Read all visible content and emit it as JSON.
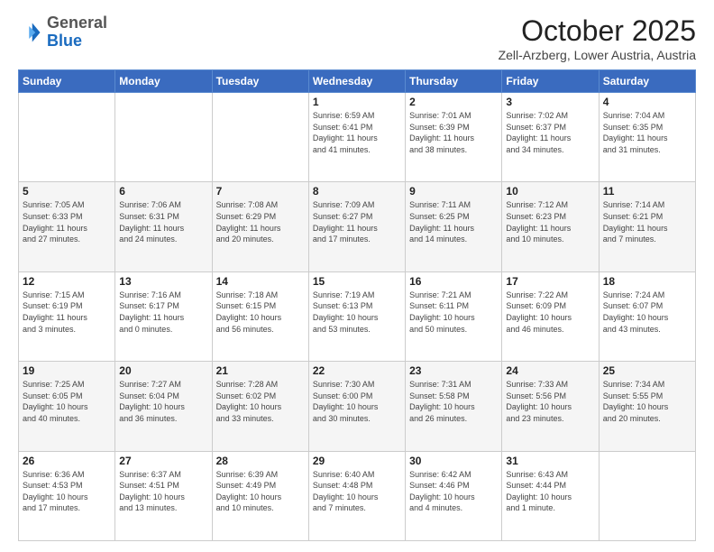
{
  "header": {
    "logo_general": "General",
    "logo_blue": "Blue",
    "month_title": "October 2025",
    "location": "Zell-Arzberg, Lower Austria, Austria"
  },
  "days_of_week": [
    "Sunday",
    "Monday",
    "Tuesday",
    "Wednesday",
    "Thursday",
    "Friday",
    "Saturday"
  ],
  "weeks": [
    [
      {
        "day": "",
        "info": ""
      },
      {
        "day": "",
        "info": ""
      },
      {
        "day": "",
        "info": ""
      },
      {
        "day": "1",
        "info": "Sunrise: 6:59 AM\nSunset: 6:41 PM\nDaylight: 11 hours\nand 41 minutes."
      },
      {
        "day": "2",
        "info": "Sunrise: 7:01 AM\nSunset: 6:39 PM\nDaylight: 11 hours\nand 38 minutes."
      },
      {
        "day": "3",
        "info": "Sunrise: 7:02 AM\nSunset: 6:37 PM\nDaylight: 11 hours\nand 34 minutes."
      },
      {
        "day": "4",
        "info": "Sunrise: 7:04 AM\nSunset: 6:35 PM\nDaylight: 11 hours\nand 31 minutes."
      }
    ],
    [
      {
        "day": "5",
        "info": "Sunrise: 7:05 AM\nSunset: 6:33 PM\nDaylight: 11 hours\nand 27 minutes."
      },
      {
        "day": "6",
        "info": "Sunrise: 7:06 AM\nSunset: 6:31 PM\nDaylight: 11 hours\nand 24 minutes."
      },
      {
        "day": "7",
        "info": "Sunrise: 7:08 AM\nSunset: 6:29 PM\nDaylight: 11 hours\nand 20 minutes."
      },
      {
        "day": "8",
        "info": "Sunrise: 7:09 AM\nSunset: 6:27 PM\nDaylight: 11 hours\nand 17 minutes."
      },
      {
        "day": "9",
        "info": "Sunrise: 7:11 AM\nSunset: 6:25 PM\nDaylight: 11 hours\nand 14 minutes."
      },
      {
        "day": "10",
        "info": "Sunrise: 7:12 AM\nSunset: 6:23 PM\nDaylight: 11 hours\nand 10 minutes."
      },
      {
        "day": "11",
        "info": "Sunrise: 7:14 AM\nSunset: 6:21 PM\nDaylight: 11 hours\nand 7 minutes."
      }
    ],
    [
      {
        "day": "12",
        "info": "Sunrise: 7:15 AM\nSunset: 6:19 PM\nDaylight: 11 hours\nand 3 minutes."
      },
      {
        "day": "13",
        "info": "Sunrise: 7:16 AM\nSunset: 6:17 PM\nDaylight: 11 hours\nand 0 minutes."
      },
      {
        "day": "14",
        "info": "Sunrise: 7:18 AM\nSunset: 6:15 PM\nDaylight: 10 hours\nand 56 minutes."
      },
      {
        "day": "15",
        "info": "Sunrise: 7:19 AM\nSunset: 6:13 PM\nDaylight: 10 hours\nand 53 minutes."
      },
      {
        "day": "16",
        "info": "Sunrise: 7:21 AM\nSunset: 6:11 PM\nDaylight: 10 hours\nand 50 minutes."
      },
      {
        "day": "17",
        "info": "Sunrise: 7:22 AM\nSunset: 6:09 PM\nDaylight: 10 hours\nand 46 minutes."
      },
      {
        "day": "18",
        "info": "Sunrise: 7:24 AM\nSunset: 6:07 PM\nDaylight: 10 hours\nand 43 minutes."
      }
    ],
    [
      {
        "day": "19",
        "info": "Sunrise: 7:25 AM\nSunset: 6:05 PM\nDaylight: 10 hours\nand 40 minutes."
      },
      {
        "day": "20",
        "info": "Sunrise: 7:27 AM\nSunset: 6:04 PM\nDaylight: 10 hours\nand 36 minutes."
      },
      {
        "day": "21",
        "info": "Sunrise: 7:28 AM\nSunset: 6:02 PM\nDaylight: 10 hours\nand 33 minutes."
      },
      {
        "day": "22",
        "info": "Sunrise: 7:30 AM\nSunset: 6:00 PM\nDaylight: 10 hours\nand 30 minutes."
      },
      {
        "day": "23",
        "info": "Sunrise: 7:31 AM\nSunset: 5:58 PM\nDaylight: 10 hours\nand 26 minutes."
      },
      {
        "day": "24",
        "info": "Sunrise: 7:33 AM\nSunset: 5:56 PM\nDaylight: 10 hours\nand 23 minutes."
      },
      {
        "day": "25",
        "info": "Sunrise: 7:34 AM\nSunset: 5:55 PM\nDaylight: 10 hours\nand 20 minutes."
      }
    ],
    [
      {
        "day": "26",
        "info": "Sunrise: 6:36 AM\nSunset: 4:53 PM\nDaylight: 10 hours\nand 17 minutes."
      },
      {
        "day": "27",
        "info": "Sunrise: 6:37 AM\nSunset: 4:51 PM\nDaylight: 10 hours\nand 13 minutes."
      },
      {
        "day": "28",
        "info": "Sunrise: 6:39 AM\nSunset: 4:49 PM\nDaylight: 10 hours\nand 10 minutes."
      },
      {
        "day": "29",
        "info": "Sunrise: 6:40 AM\nSunset: 4:48 PM\nDaylight: 10 hours\nand 7 minutes."
      },
      {
        "day": "30",
        "info": "Sunrise: 6:42 AM\nSunset: 4:46 PM\nDaylight: 10 hours\nand 4 minutes."
      },
      {
        "day": "31",
        "info": "Sunrise: 6:43 AM\nSunset: 4:44 PM\nDaylight: 10 hours\nand 1 minute."
      },
      {
        "day": "",
        "info": ""
      }
    ]
  ]
}
